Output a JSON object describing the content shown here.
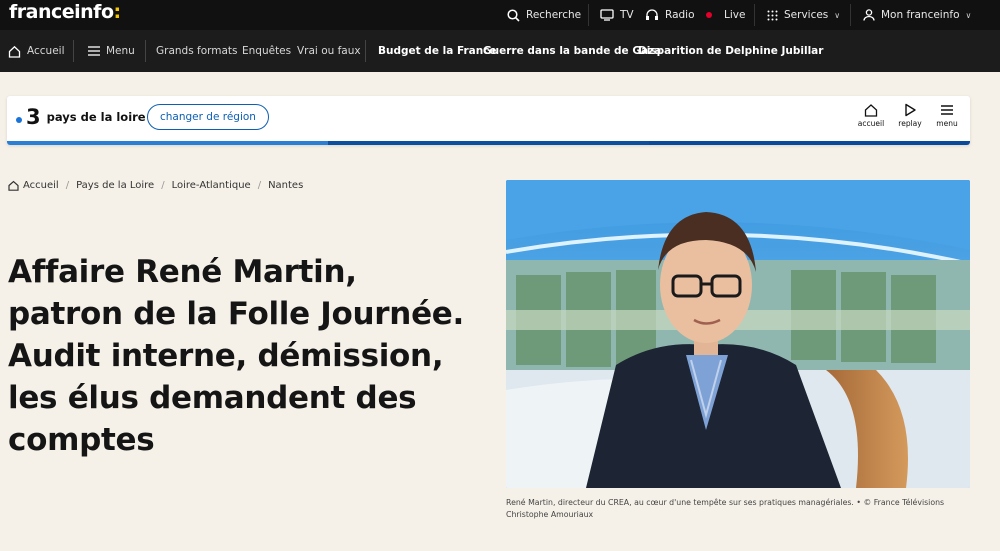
{
  "topbar": {
    "logo_main": "franceinfo",
    "logo_colon": ":",
    "search": "Recherche",
    "tv": "TV",
    "radio": "Radio",
    "live": "Live",
    "services": "Services",
    "account": "Mon franceinfo"
  },
  "nav": {
    "home": "Accueil",
    "menu": "Menu",
    "items": [
      "Grands formats",
      "Enquêtes",
      "Vrai ou faux"
    ],
    "topics": [
      "Budget de la France",
      "Guerre dans la bande de Gaza",
      "Disparition de Delphine Jubillar"
    ]
  },
  "region": {
    "channel_number": "3",
    "name": "pays de la loire",
    "change_button": "changer de région",
    "home_label": "accueil",
    "replay_label": "replay",
    "menu_label": "menu",
    "colors": {
      "accent": "#0d5fb3",
      "bar_left": "#2a7fd4",
      "bar_right": "#0a4a9a"
    }
  },
  "breadcrumb": [
    "Accueil",
    "Pays de la Loire",
    "Loire-Atlantique",
    "Nantes"
  ],
  "article": {
    "headline_lines": [
      "Affaire René Martin,",
      "patron de la Folle Journée.",
      "Audit interne, démission,",
      "les élus demandent des",
      "comptes"
    ],
    "caption_line1": "René Martin, directeur du CREA, au cœur d'une tempête sur ses pratiques managériales. • © France Télévisions",
    "caption_line2": "Christophe Amouriaux"
  }
}
